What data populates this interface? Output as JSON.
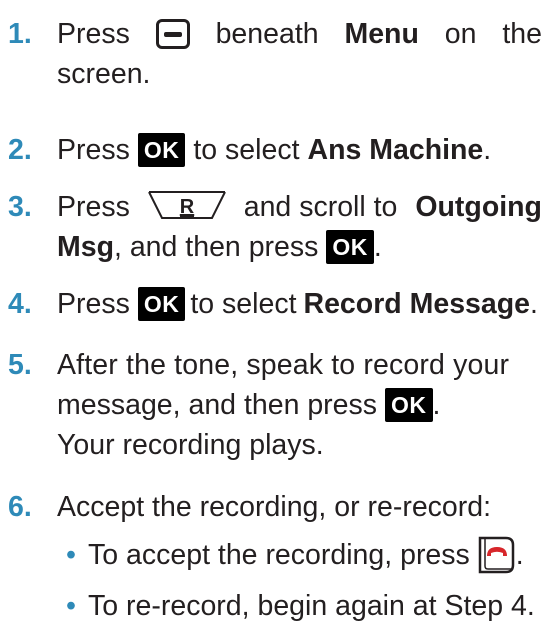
{
  "steps": [
    {
      "number": "1.",
      "parts": {
        "a": "Press",
        "b": "beneath",
        "c": "Menu",
        "d": "on",
        "e": "the"
      },
      "line2": "screen.",
      "icon": "softkey-menu-icon"
    },
    {
      "number": "2.",
      "parts": {
        "a": "Press",
        "b": "to select",
        "c": "Ans Machine",
        "d": "."
      },
      "icon": "ok-key-icon"
    },
    {
      "number": "3.",
      "parts": {
        "a": "Press",
        "b": "and scroll to",
        "c": "Outgoing",
        "d": "Msg",
        "e": ", and then press",
        "f": "."
      },
      "icon": "r-key-icon"
    },
    {
      "number": "4.",
      "parts": {
        "a": "Press",
        "b": "to select",
        "c": "Record Message",
        "d": "."
      },
      "icon": "ok-key-icon"
    },
    {
      "number": "5.",
      "line1": "After the tone, speak to record your",
      "line2a": "message, and then press",
      "line2b": ".",
      "line3": "Your recording plays.",
      "icon": "ok-key-icon"
    },
    {
      "number": "6.",
      "line1": "Accept the recording, or re-record:",
      "bullets": [
        {
          "text": "To accept the recording, press",
          "end": ".",
          "icon": "end-call-key-icon"
        },
        {
          "text": "To re-record, begin again at Step 4."
        }
      ]
    }
  ],
  "keys": {
    "ok": "OK",
    "r": "R"
  },
  "colors": {
    "step_number": "#2e8ab8",
    "text": "#231f20",
    "key_background": "#000000",
    "end_call_red": "#d7262b"
  }
}
